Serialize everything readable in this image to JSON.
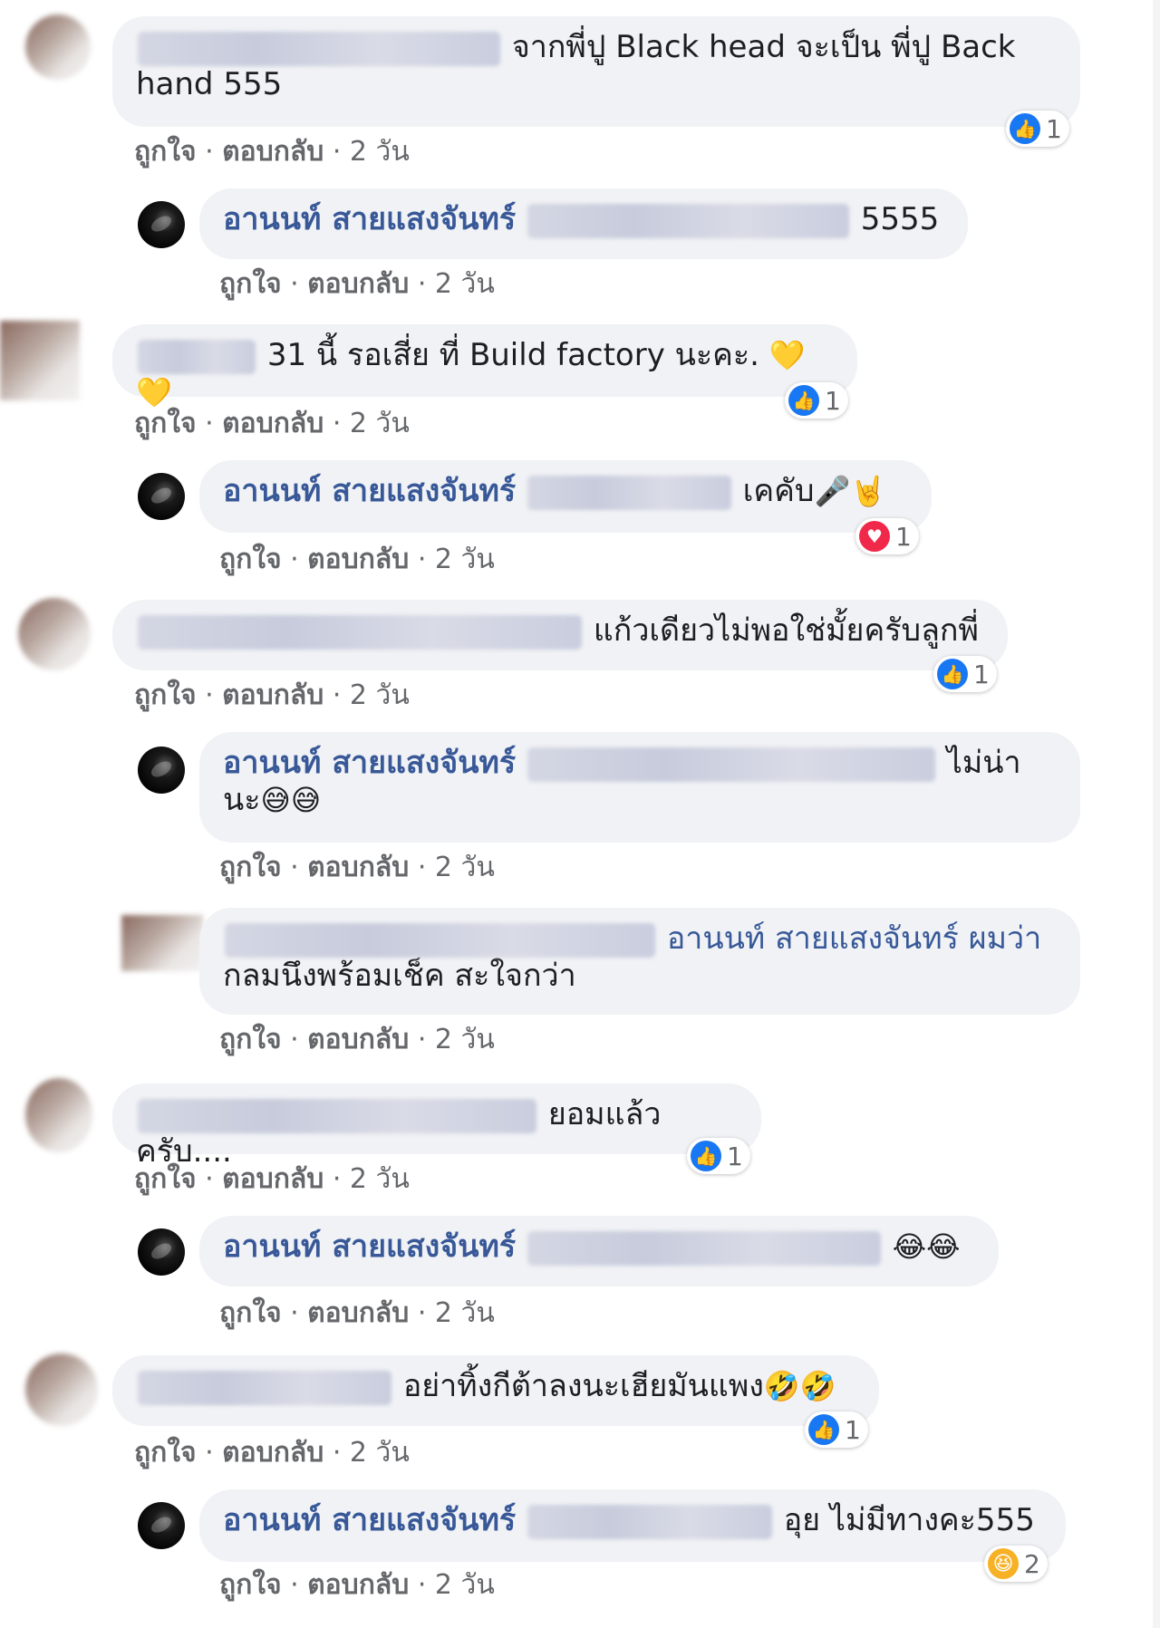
{
  "actions": {
    "like": "ถูกใจ",
    "reply": "ตอบกลับ",
    "sep": " · ",
    "time": "2 วัน"
  },
  "owner_name": "อานนท์ สายแสงจันทร์",
  "comments": [
    {
      "text_part1": "จากพี่ปู Black head จะเป็น พี่ปู Back",
      "text_part2": "hand 555",
      "reaction": {
        "type": "like",
        "count": "1"
      }
    },
    {
      "text": "5555"
    },
    {
      "text": "31 นี้ รอเสี่ย ที่ Build factory นะคะ.",
      "emoji": "💛💛",
      "reaction": {
        "type": "like",
        "count": "1"
      }
    },
    {
      "text": "เคคับ",
      "emoji": "🎤🤘",
      "reaction": {
        "type": "love",
        "count": "1"
      }
    },
    {
      "text": "แก้วเดียวไม่พอใช่มั้ยครับลูกพี่",
      "reaction": {
        "type": "like",
        "count": "1"
      }
    },
    {
      "text_part1": "ไม่น่า",
      "text_part2": "นะ",
      "emoji": "😅😅"
    },
    {
      "text_part1": "อานนท์ สายแสงจันทร์ ผมว่า",
      "text_part2": "กลมนึงพร้อมเช็ค สะใจกว่า"
    },
    {
      "text": "ยอมแล้วครับ....",
      "reaction": {
        "type": "like",
        "count": "1"
      }
    },
    {
      "emoji": "😂😂"
    },
    {
      "text": "อย่าทิ้งกีต้าลงนะเฮียมันแพง",
      "emoji": "🤣🤣",
      "reaction": {
        "type": "like",
        "count": "1"
      }
    },
    {
      "text": "อุย ไม่มีทางคะ555",
      "reaction": {
        "type": "haha",
        "count": "2"
      }
    }
  ]
}
